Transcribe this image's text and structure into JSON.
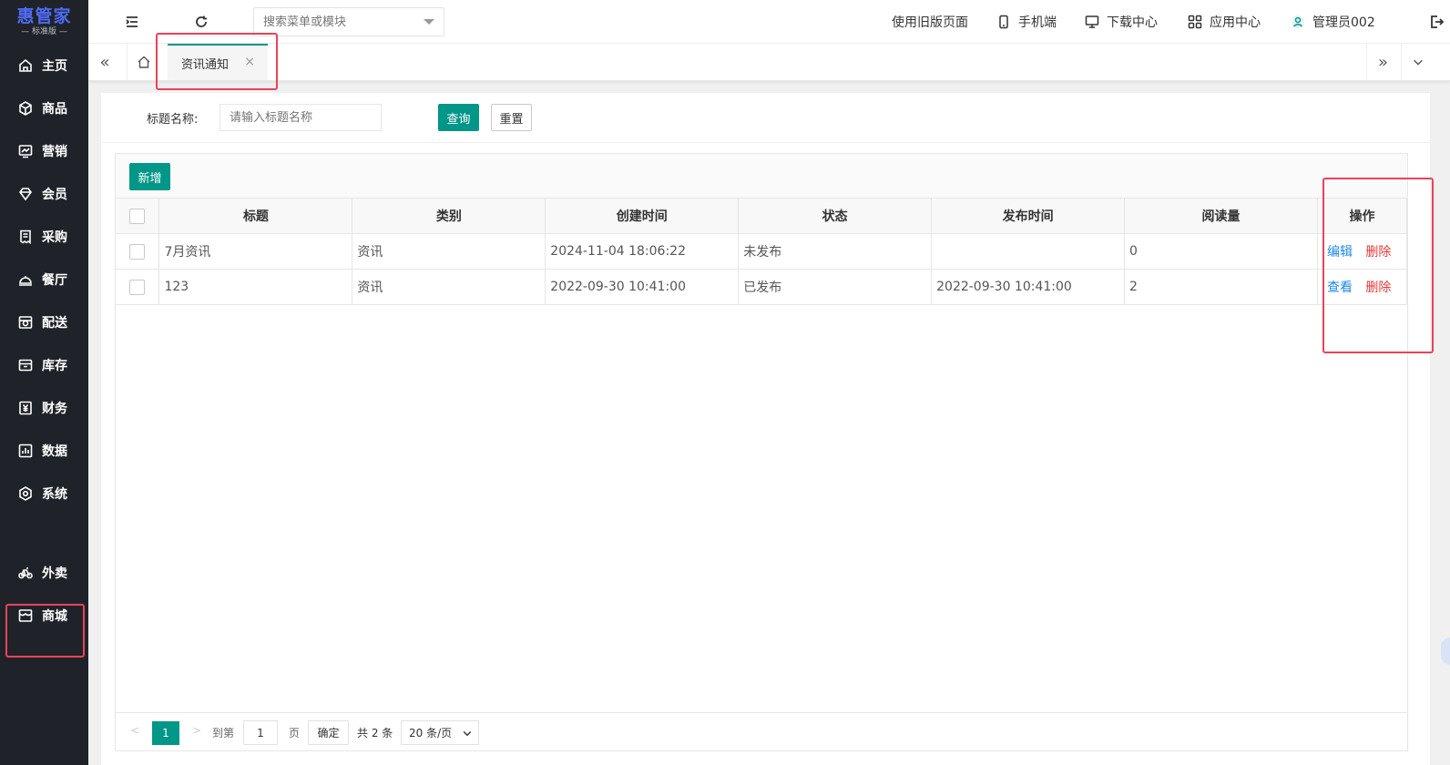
{
  "logo": {
    "brand": "惠管家",
    "edition": "— 标准版 —"
  },
  "sidebar": {
    "items": [
      {
        "label": "主页",
        "icon": "home-icon"
      },
      {
        "label": "商品",
        "icon": "box-icon"
      },
      {
        "label": "营销",
        "icon": "chart-line-icon"
      },
      {
        "label": "会员",
        "icon": "diamond-icon"
      },
      {
        "label": "采购",
        "icon": "receipt-icon"
      },
      {
        "label": "餐厅",
        "icon": "cloche-icon"
      },
      {
        "label": "配送",
        "icon": "delivery-icon"
      },
      {
        "label": "库存",
        "icon": "archive-icon"
      },
      {
        "label": "财务",
        "icon": "yuan-icon"
      },
      {
        "label": "数据",
        "icon": "bar-chart-icon"
      },
      {
        "label": "系统",
        "icon": "settings-icon"
      },
      {
        "label": "外卖",
        "icon": "bike-icon"
      },
      {
        "label": "商城",
        "icon": "store-icon"
      }
    ]
  },
  "topbar": {
    "search_placeholder": "搜索菜单或模块",
    "old_page": "使用旧版页面",
    "mobile": "手机端",
    "download": "下载中心",
    "apps": "应用中心",
    "user": "管理员002"
  },
  "tabs": {
    "active": "资讯通知",
    "close": "×",
    "prev": "«",
    "next": "»"
  },
  "filter": {
    "label": "标题名称:",
    "placeholder": "请输入标题名称",
    "search_btn": "查询",
    "reset_btn": "重置"
  },
  "toolbar": {
    "add_btn": "新增"
  },
  "table": {
    "headers": [
      "标题",
      "类别",
      "创建时间",
      "状态",
      "发布时间",
      "阅读量",
      "操作"
    ],
    "rows": [
      {
        "title": "7月资讯",
        "category": "资讯",
        "created": "2024-11-04 18:06:22",
        "status": "未发布",
        "published": "",
        "reads": "0",
        "op1": "编辑",
        "op2": "删除"
      },
      {
        "title": "123",
        "category": "资讯",
        "created": "2022-09-30 10:41:00",
        "status": "已发布",
        "published": "2022-09-30 10:41:00",
        "reads": "2",
        "op1": "查看",
        "op2": "删除"
      }
    ]
  },
  "pager": {
    "current": "1",
    "goto_label": "到第",
    "goto_value": "1",
    "page_unit": "页",
    "confirm": "确定",
    "total": "共 2 条",
    "page_size": "20 条/页"
  },
  "colors": {
    "primary": "#009688",
    "sidebar_bg": "#1f2329",
    "highlight": "#e8435a",
    "link_blue": "#1e88e5",
    "link_red": "#e53935"
  }
}
